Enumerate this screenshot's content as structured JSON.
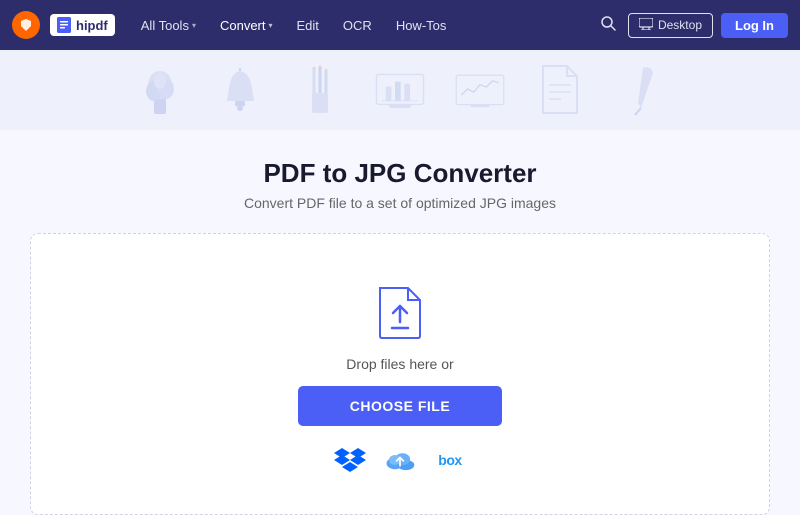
{
  "brand": {
    "wondershare_label": "W",
    "hipdf_label": "hipdf"
  },
  "navbar": {
    "items": [
      {
        "label": "All Tools",
        "has_dropdown": true
      },
      {
        "label": "Convert",
        "has_dropdown": true
      },
      {
        "label": "Edit",
        "has_dropdown": false
      },
      {
        "label": "OCR",
        "has_dropdown": false
      },
      {
        "label": "How-Tos",
        "has_dropdown": false
      }
    ],
    "desktop_btn_label": "Desktop",
    "login_btn_label": "Log In"
  },
  "page": {
    "title": "PDF to JPG Converter",
    "subtitle": "Convert PDF file to a set of optimized JPG images"
  },
  "dropzone": {
    "drop_text": "Drop files here or",
    "choose_file_label": "CHOOSE FILE",
    "cloud_services": [
      "dropbox",
      "onedrive",
      "box"
    ]
  }
}
